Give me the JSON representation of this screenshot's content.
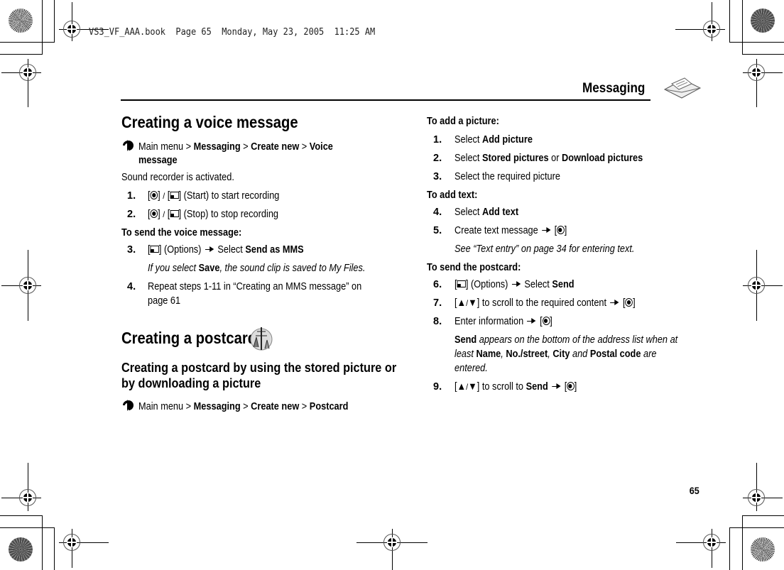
{
  "slug": "VS3_VF_AAA.book  Page 65  Monday, May 23, 2005  11:25 AM",
  "header": {
    "title": "Messaging",
    "icon": "envelope-icon"
  },
  "left": {
    "voice_title": "Creating a voice message",
    "voice_path": {
      "prefix": "Main menu > ",
      "p1": "Messaging",
      "sep1": " > ",
      "p2": "Create new",
      "sep2": " > ",
      "p3": "Voice",
      "p3b": "message"
    },
    "voice_intro": "Sound recorder is activated.",
    "steps": [
      {
        "num": "1.",
        "text": "(Start) to start recording"
      },
      {
        "num": "2.",
        "text": "(Stop) to stop recording"
      }
    ],
    "send_heading": "To send the voice message:",
    "step3": {
      "num": "3.",
      "pre": "(Options)",
      "select": "Select ",
      "bold": "Send as MMS"
    },
    "step3_note": {
      "pre": "If you select ",
      "bold": "Save",
      "post": ", the sound clip is saved to My Files."
    },
    "step4": {
      "num": "4.",
      "line1": "Repeat steps 1-11 in “Creating an MMS message” on",
      "line2": "page 61"
    },
    "postcard_title": "Creating a postcard",
    "postcard_sub_line1": "Creating a postcard by using the stored picture or",
    "postcard_sub_line2": "by downloading a picture",
    "postcard_path": {
      "prefix": "Main menu > ",
      "p1": "Messaging",
      "sep1": " > ",
      "p2": "Create new",
      "sep2": " > ",
      "p3": "Postcard"
    }
  },
  "right": {
    "add_picture_heading": "To add a picture:",
    "s1": {
      "num": "1.",
      "pre": "Select ",
      "bold": "Add picture"
    },
    "s2": {
      "num": "2.",
      "pre": "Select ",
      "bold1": "Stored pictures",
      "mid": " or ",
      "bold2": "Download pictures"
    },
    "s3": {
      "num": "3.",
      "text": "Select the required picture"
    },
    "add_text_heading": "To add text:",
    "s4": {
      "num": "4.",
      "pre": "Select ",
      "bold": "Add text"
    },
    "s5": {
      "num": "5.",
      "text": "Create text message"
    },
    "s5_note": "See “Text entry” on page 34 for entering text.",
    "send_heading": "To send the postcard:",
    "s6": {
      "num": "6.",
      "pre": "(Options)",
      "select": "Select ",
      "bold": "Send"
    },
    "s7": {
      "num": "7.",
      "text": "to scroll to the required content"
    },
    "s8": {
      "num": "8.",
      "text": "Enter information"
    },
    "s8_note": {
      "b1": "Send",
      "t1": " appears on the bottom of the address list when at",
      "t2": "least ",
      "b2": "Name",
      "c1": ", ",
      "b3": "No./street",
      "c2": ", ",
      "b4": "City",
      "t3": " and ",
      "b5": "Postal code",
      "t4": " are",
      "t5": "entered."
    },
    "s9": {
      "num": "9.",
      "pre": "to scroll to ",
      "bold": "Send"
    }
  },
  "page_number": "65"
}
